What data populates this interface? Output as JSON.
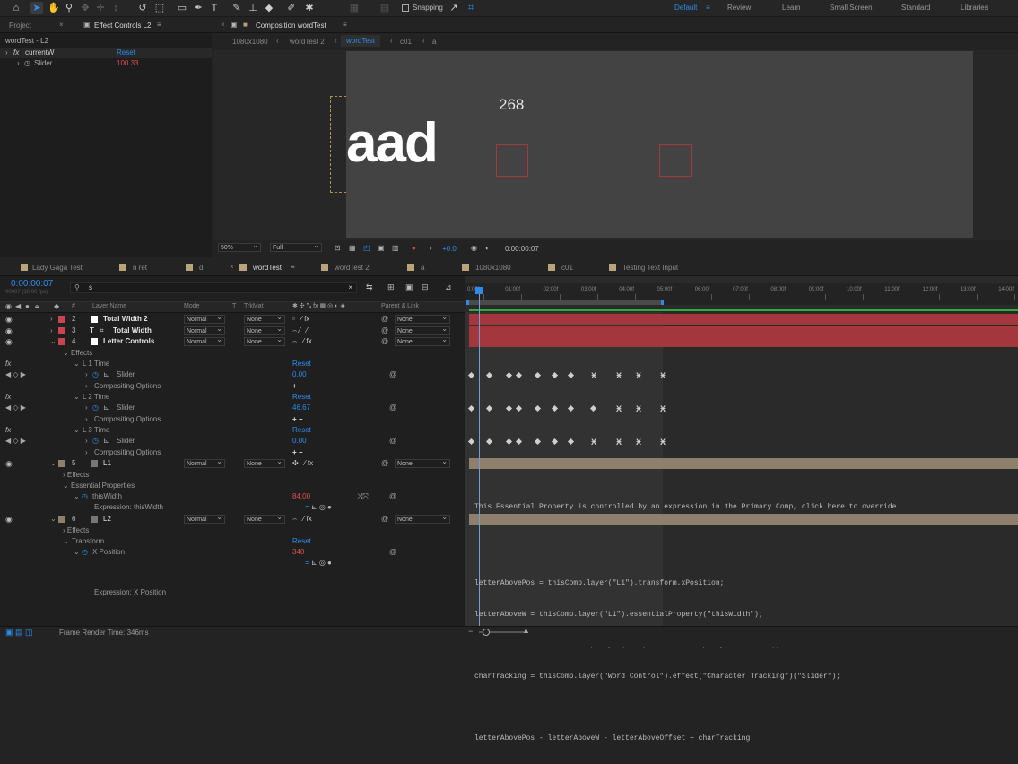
{
  "workspaces": [
    "Default",
    "Review",
    "Learn",
    "Small Screen",
    "Standard",
    "Libraries"
  ],
  "snapping_label": "Snapping",
  "left_panel": {
    "tabs": [
      "Project",
      "Effect Controls L2"
    ],
    "layer_title": "wordTest - L2",
    "effect_name": "currentW",
    "reset_label": "Reset",
    "slider_label": "Slider",
    "slider_value": "100.33"
  },
  "comp_panel": {
    "tab_label": "Composition wordTest",
    "breadcrumbs": [
      "1080x1080",
      "wordTest 2",
      "wordTest",
      "c01",
      "a"
    ],
    "counter_text": "268",
    "big_text": "aad",
    "zoom": "50%",
    "resolution": "Full",
    "exposure": "+0.0",
    "timecode": "0:00:00:07"
  },
  "timeline": {
    "tabs": [
      "Lady Gaga Test",
      "n ret",
      "d",
      "wordTest",
      "wordTest 2",
      "a",
      "1080x1080",
      "c01",
      "Testing Text Input"
    ],
    "current_time": "0:00:00:07",
    "fps_text": "00007 (30.00 fps)",
    "search_value": "s",
    "col_headers": [
      "#",
      "Layer Name",
      "Mode",
      "T",
      "TrkMat",
      "Parent & Link"
    ],
    "ruler_ticks": [
      "0:00f",
      "01:00f",
      "02:00f",
      "03:00f",
      "04:00f",
      "05:00f",
      "06:00f",
      "07:00f",
      "08:00f",
      "09:00f",
      "10:00f",
      "11:00f",
      "12:00f",
      "13:00f",
      "14:00f"
    ],
    "mode": "Normal",
    "none": "None",
    "layers": [
      {
        "num": "2",
        "name": "Total Width 2",
        "type": "T"
      },
      {
        "num": "3",
        "name": "Total Width",
        "type": "T"
      },
      {
        "num": "4",
        "name": "Letter Controls",
        "type": ""
      }
    ],
    "effects_label": "Effects",
    "l1time": "L 1 Time",
    "l2time": "L 2 Time",
    "l3time": "L 3 Time",
    "reset_label": "Reset",
    "slider_label": "Slider",
    "compositing_label": "Compositing Options",
    "l1_value": "0.00",
    "l2_value": "46.67",
    "l3_value": "0.00",
    "layer5": {
      "num": "5",
      "name": "L1"
    },
    "essential_label": "Essential Properties",
    "thiswidth_label": "thisWidth",
    "thiswidth_value": "84.00",
    "expr_thiswidth": "Expression: thisWidth",
    "layer6": {
      "num": "6",
      "name": "L2"
    },
    "transform_label": "Transform",
    "xposition_label": "X Position",
    "xposition_value": "340",
    "expr_xposition": "Expression: X Position",
    "essential_msg": "This Essential Property is controlled by an expression in the Primary Comp, click here to override",
    "code_lines": [
      "letterAbovePos = thisComp.layer(\"L1\").transform.xPosition;",
      "letterAboveW = thisComp.layer(\"L1\").essentialProperty(\"thisWidth\");",
      "letterAboveOffset = thisComp.layer(\"L1\").essentialProperty(\"Offset X\");",
      "charTracking = thisComp.layer(\"Word Control\").effect(\"Character Tracking\")(\"Slider\");",
      "",
      "letterAbovePos - letterAboveW - letterAboveOffset + charTracking"
    ],
    "render_time": "Frame Render Time: 346ms"
  },
  "colors": {
    "accent": "#2d8ceb",
    "layer_red": "#a3373d",
    "layer_tan": "#8f7f6d"
  }
}
